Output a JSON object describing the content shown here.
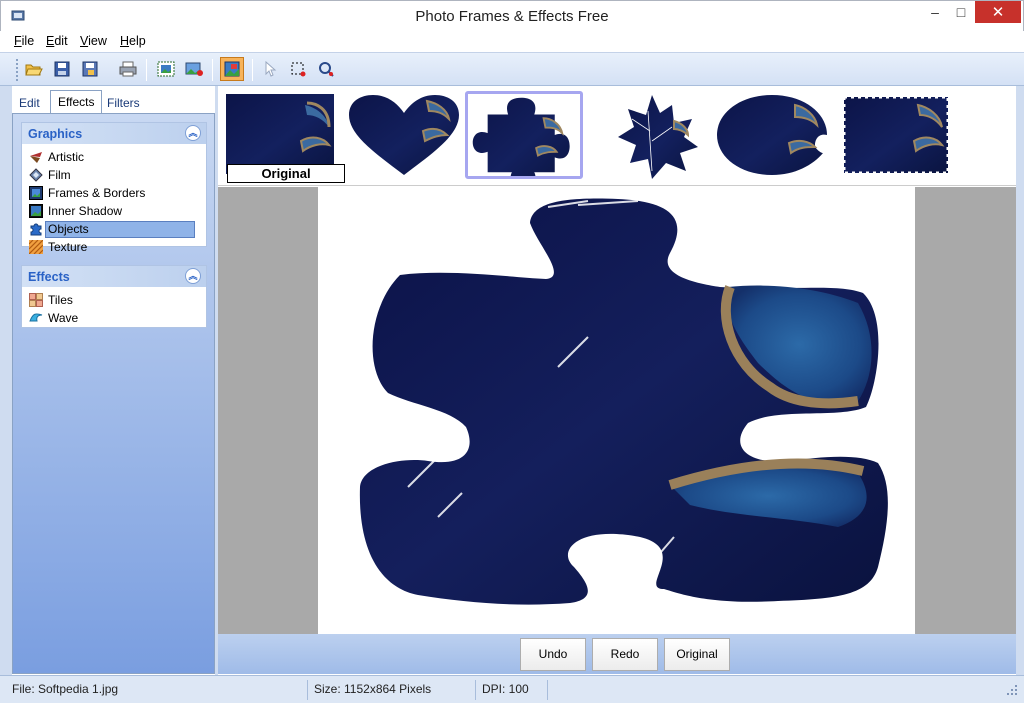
{
  "window": {
    "title": "Photo Frames & Effects Free",
    "minimize": "–",
    "maximize": "□",
    "close": "✕"
  },
  "menu": [
    {
      "pre": "",
      "u": "F",
      "post": "ile"
    },
    {
      "pre": "",
      "u": "E",
      "post": "dit"
    },
    {
      "pre": "",
      "u": "V",
      "post": "iew"
    },
    {
      "pre": "",
      "u": "H",
      "post": "elp"
    }
  ],
  "toolbar": {
    "icons": [
      "open-icon",
      "save-icon",
      "save-as-icon",
      "print-icon",
      "frame-icon",
      "image-add-icon",
      "effects-icon",
      "pointer-icon",
      "select-icon",
      "zoom-icon"
    ],
    "active": "effects-icon"
  },
  "tabs": [
    {
      "label": "Edit",
      "active": false
    },
    {
      "label": "Effects",
      "active": true
    },
    {
      "label": "Filters",
      "active": false
    }
  ],
  "groups": {
    "graphics": {
      "title": "Graphics",
      "items": [
        {
          "label": "Artistic",
          "icon": "artistic-icon"
        },
        {
          "label": "Film",
          "icon": "film-icon"
        },
        {
          "label": "Frames & Borders",
          "icon": "frames-icon"
        },
        {
          "label": "Inner Shadow",
          "icon": "inner-shadow-icon"
        },
        {
          "label": "Objects",
          "icon": "objects-icon",
          "selected": true
        },
        {
          "label": "Texture",
          "icon": "texture-icon"
        }
      ]
    },
    "effects": {
      "title": "Effects",
      "items": [
        {
          "label": "Tiles",
          "icon": "tiles-icon"
        },
        {
          "label": "Wave",
          "icon": "wave-icon"
        }
      ]
    }
  },
  "thumbnails": {
    "original_label": "Original",
    "items": [
      "original",
      "heart",
      "puzzle",
      "leaf",
      "oval",
      "rough-rect"
    ],
    "selected": "puzzle"
  },
  "actions": {
    "undo": "Undo",
    "redo": "Redo",
    "original": "Original"
  },
  "status": {
    "file": "File: Softpedia 1.jpg",
    "size": "Size: 1152x864 Pixels",
    "dpi": "DPI: 100"
  },
  "colors": {
    "accent": "#2a62c6",
    "photo_dark": "#0d1650",
    "close_red": "#c7312b"
  }
}
